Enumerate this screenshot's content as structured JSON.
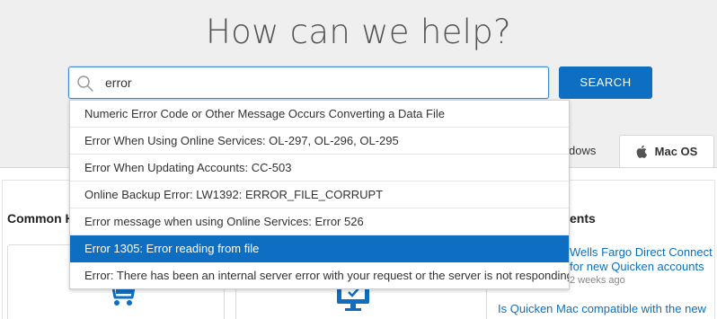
{
  "hero": {
    "title": "How can we help?"
  },
  "search": {
    "value": "error",
    "button_label": "SEARCH"
  },
  "suggestions": [
    "Numeric Error Code or Other Message Occurs Converting a Data File",
    "Error When Using Online Services: OL-297, OL-296, OL-295",
    "Error When Updating Accounts: CC-503",
    "Online Backup Error: LW1392: ERROR_FILE_CORRUPT",
    "Error message when using Online Services: Error 526",
    "Error 1305: Error reading from file",
    "Error: There has been an internal server error with your request or the server is not responding."
  ],
  "selected_suggestion_index": 5,
  "tabs": {
    "windows_partial": "dows",
    "mac": "Mac OS"
  },
  "sections": {
    "common_partial": "Common H",
    "recent_partial": "ents"
  },
  "articles": [
    {
      "title": "Wells Fargo Direct Connect for new Quicken accounts",
      "time": "2 weeks ago"
    },
    {
      "title": "Is Quicken Mac compatible with the new"
    }
  ],
  "colors": {
    "accent": "#0e6fc2",
    "selected_bg": "#0e6fc2"
  },
  "icons": {
    "search": "search-icon",
    "apple": "apple-icon",
    "cart": "cart-icon",
    "monitor": "monitor-icon"
  }
}
